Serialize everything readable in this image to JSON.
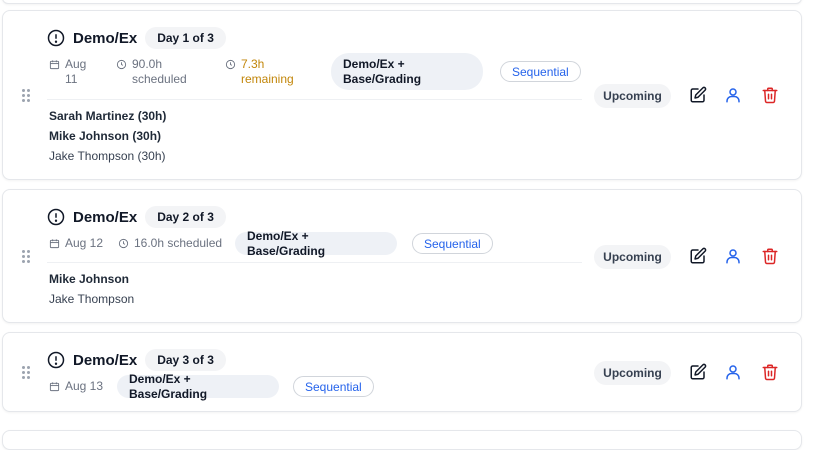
{
  "colors": {
    "accent_blue": "#2563eb",
    "warning_orange": "#c2860a",
    "danger_red": "#dc2626"
  },
  "tasks": [
    {
      "title": "Demo/Ex",
      "day": "Day 1 of 3",
      "date_month": "Aug",
      "date_day": "11",
      "scheduled_value": "90.0h",
      "scheduled_label": "scheduled",
      "remaining_value": "7.3h",
      "remaining_label": "remaining",
      "category_line1": "Demo/Ex +",
      "category_line2": "Base/Grading",
      "mode": "Sequential",
      "status": "Upcoming",
      "assignees": [
        "Sarah Martinez (30h)",
        "Mike Johnson (30h)",
        "Jake Thompson (30h)"
      ]
    },
    {
      "title": "Demo/Ex",
      "day": "Day 2 of 3",
      "date": "Aug 12",
      "scheduled": "16.0h scheduled",
      "category": "Demo/Ex + Base/Grading",
      "mode": "Sequential",
      "status": "Upcoming",
      "assignees": [
        "Mike Johnson",
        "Jake Thompson"
      ]
    },
    {
      "title": "Demo/Ex",
      "day": "Day 3 of 3",
      "date": "Aug 13",
      "category": "Demo/Ex + Base/Grading",
      "mode": "Sequential",
      "status": "Upcoming"
    }
  ],
  "icons": {
    "warning": "alert-circle-icon",
    "calendar": "calendar-icon",
    "clock": "clock-icon",
    "drag": "drag-handle-icon",
    "edit": "edit-icon",
    "assign": "user-icon",
    "delete": "trash-icon"
  }
}
